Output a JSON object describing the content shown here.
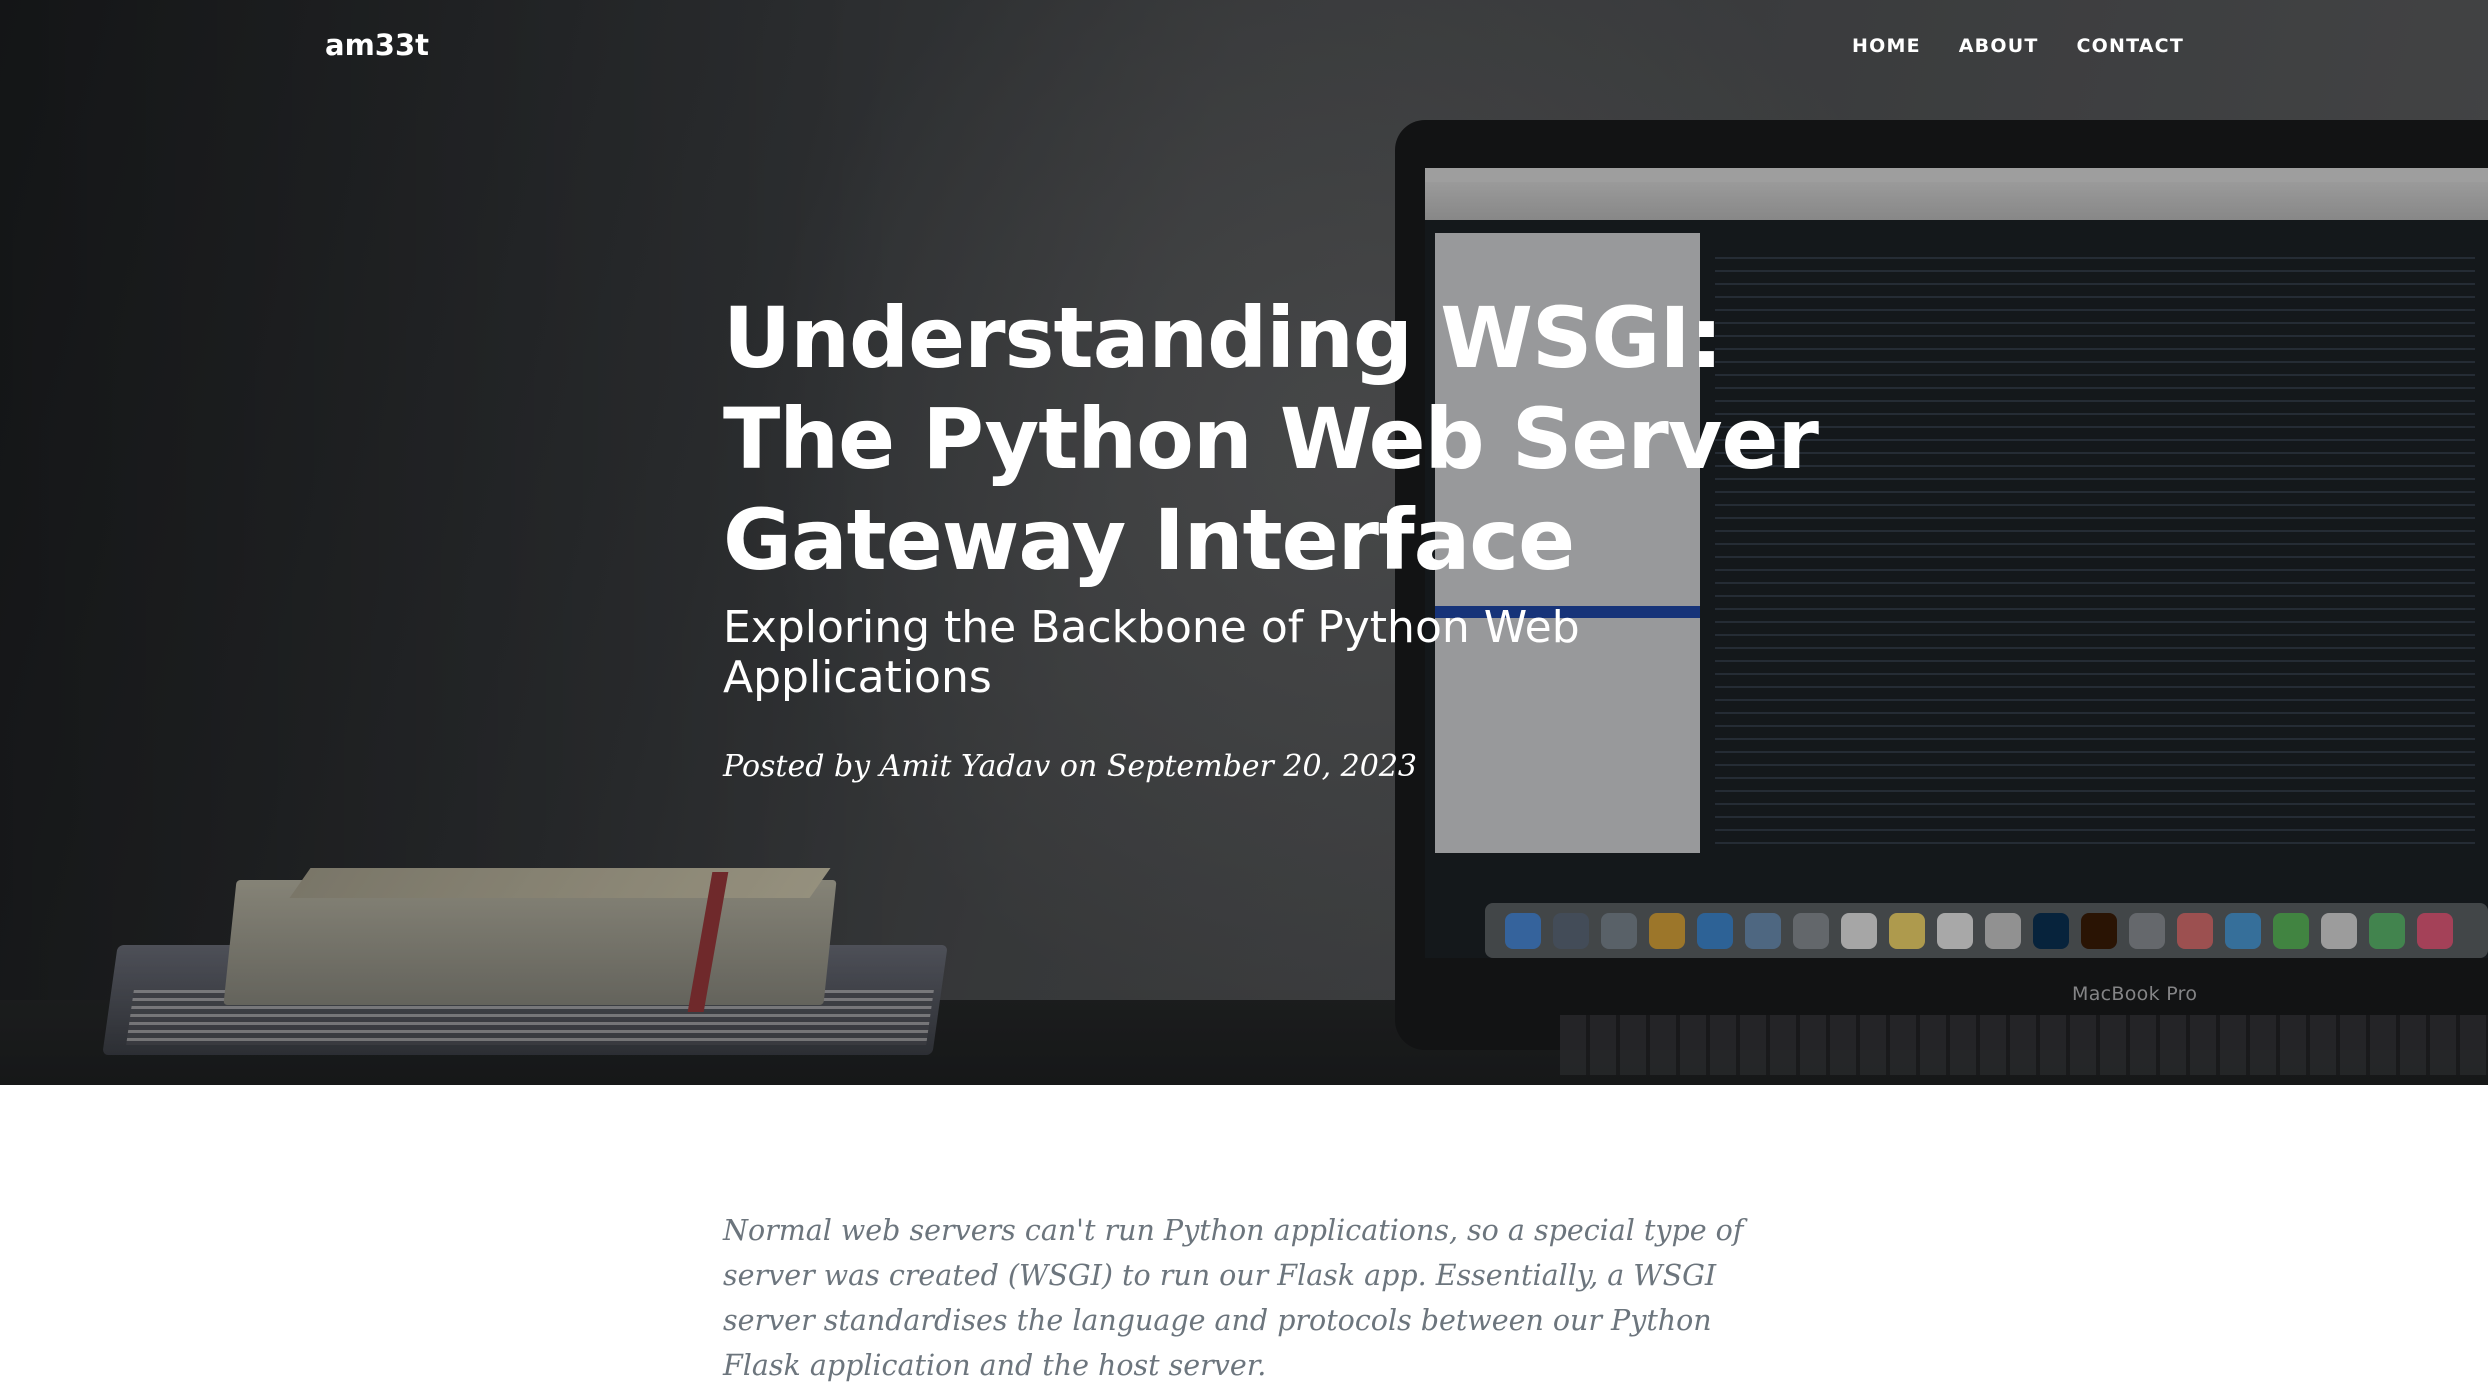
{
  "navbar": {
    "brand": "am33t",
    "links": [
      {
        "label": "HOME"
      },
      {
        "label": "ABOUT"
      },
      {
        "label": "CONTACT"
      }
    ]
  },
  "hero": {
    "title": "Understanding WSGI: The Python Web Server Gateway Interface",
    "subtitle": "Exploring the Backbone of Python Web Applications",
    "meta": "Posted by Amit Yadav on September 20, 2023",
    "background_label": "MacBook Pro"
  },
  "article": {
    "intro": "Normal web servers can't run Python applications, so a special type of server was created (WSGI) to run our Flask app.  Essentially, a WSGI server standardises the language and protocols between our Python Flask application and the host server."
  },
  "colors": {
    "hero_text": "#ffffff",
    "body_text": "#6c757d",
    "page_background": "#ffffff"
  }
}
